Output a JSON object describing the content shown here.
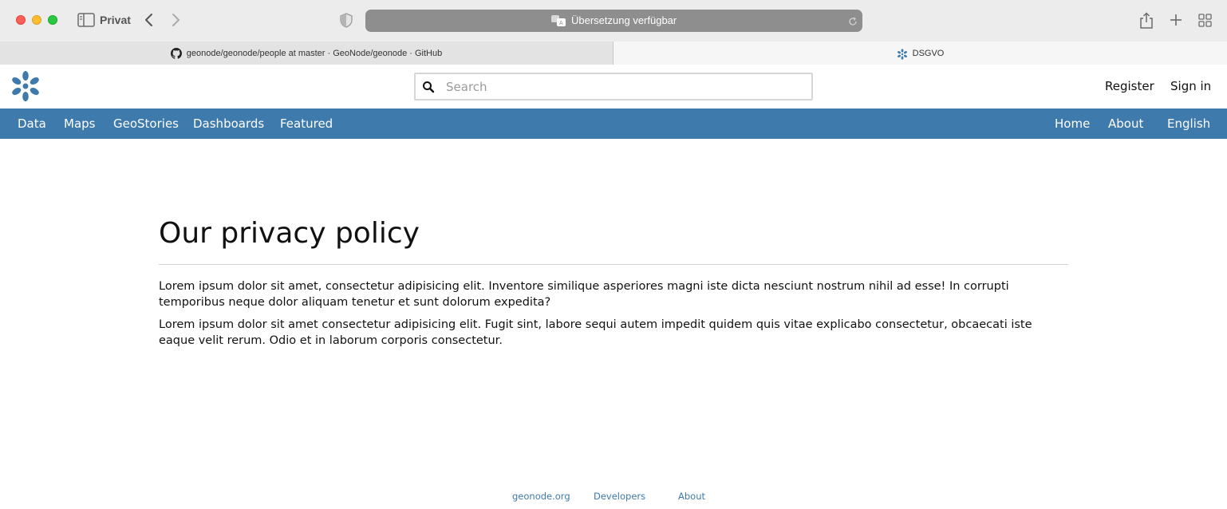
{
  "browser": {
    "profile_label": "Privat",
    "address_text": "Übersetzung verfügbar",
    "tabs": [
      {
        "title": "geonode/geonode/people at master · GeoNode/geonode · GitHub",
        "icon": "github-icon",
        "active": false
      },
      {
        "title": "DSGVO",
        "icon": "geonode-logo-icon",
        "active": true
      }
    ]
  },
  "header": {
    "search_placeholder": "Search",
    "register": "Register",
    "sign_in": "Sign in"
  },
  "nav": {
    "left": [
      "Data",
      "Maps",
      "GeoStories",
      "Dashboards",
      "Featured"
    ],
    "right": [
      "Home",
      "About",
      "English"
    ],
    "background": "#3e7aab"
  },
  "main": {
    "title": "Our privacy policy",
    "paragraphs": [
      "Lorem ipsum dolor sit amet, consectetur adipisicing elit. Inventore similique asperiores magni iste dicta nesciunt nostrum nihil ad esse! In corrupti temporibus neque dolor aliquam tenetur et sunt dolorum expedita?",
      "Lorem ipsum dolor sit amet consectetur adipisicing elit. Fugit sint, labore sequi autem impedit quidem quis vitae explicabo consectetur, obcaecati iste eaque velit rerum. Odio et in laborum corporis consectetur."
    ]
  },
  "footer": {
    "links": [
      "geonode.org",
      "Developers",
      "About"
    ],
    "link_color": "#3e7aab"
  }
}
